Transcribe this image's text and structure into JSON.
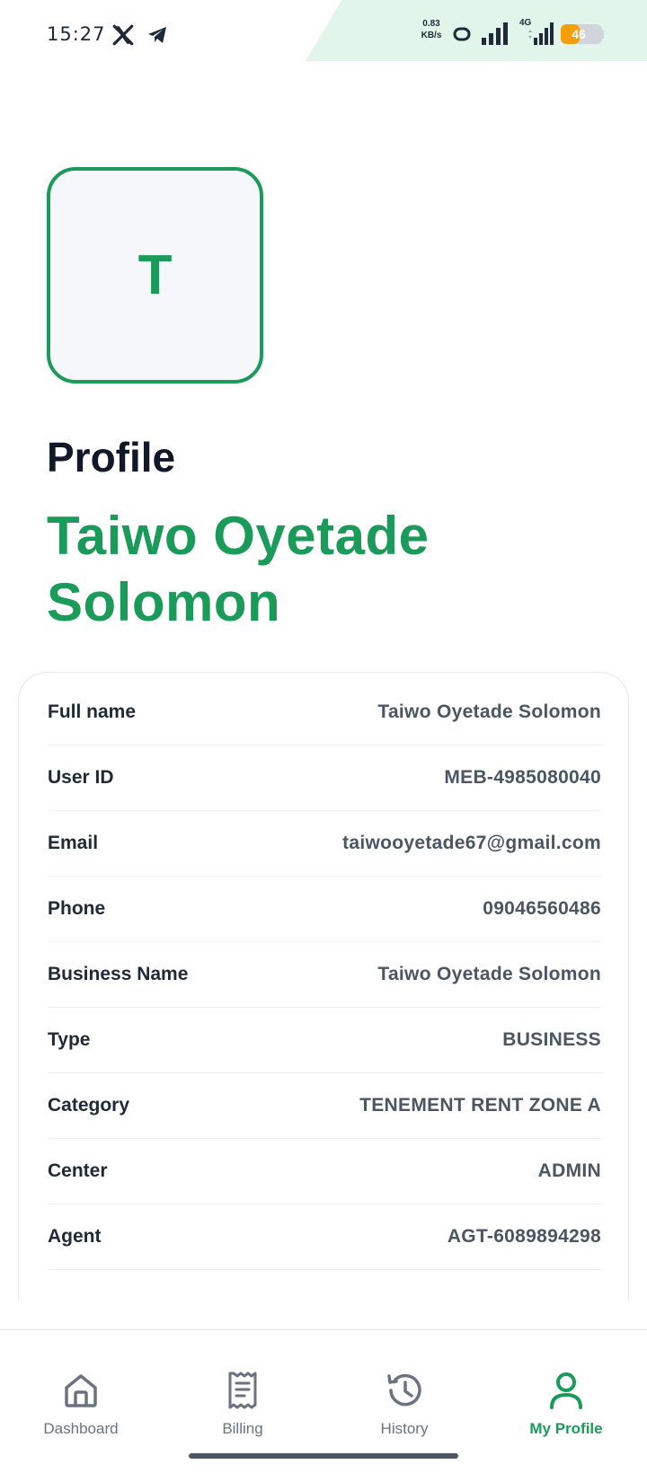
{
  "status_bar": {
    "time": "15:27",
    "net_speed_value": "0.83",
    "net_speed_unit": "KB/s",
    "network_type": "4G",
    "battery_percent": "46",
    "battery_level": 0.46,
    "accent_color": "#e2f5ea"
  },
  "avatar": {
    "initial": "T"
  },
  "page_title": "Profile",
  "user_name": "Taiwo Oyetade Solomon",
  "profile_rows": [
    {
      "label": "Full name",
      "value": "Taiwo Oyetade Solomon"
    },
    {
      "label": "User ID",
      "value": "MEB-4985080040"
    },
    {
      "label": "Email",
      "value": "taiwooyetade67@gmail.com"
    },
    {
      "label": "Phone",
      "value": "09046560486"
    },
    {
      "label": "Business Name",
      "value": "Taiwo Oyetade Solomon"
    },
    {
      "label": "Type",
      "value": "BUSINESS"
    },
    {
      "label": "Category",
      "value": "TENEMENT RENT ZONE A"
    },
    {
      "label": "Center",
      "value": "ADMIN"
    },
    {
      "label": "Agent",
      "value": "AGT-6089894298"
    }
  ],
  "bottom_nav": {
    "items": [
      {
        "label": "Dashboard",
        "icon": "home-icon",
        "active": false
      },
      {
        "label": "Billing",
        "icon": "receipt-icon",
        "active": false
      },
      {
        "label": "History",
        "icon": "history-icon",
        "active": false
      },
      {
        "label": "My Profile",
        "icon": "user-icon",
        "active": true
      }
    ]
  },
  "colors": {
    "brand": "#1a9b5a",
    "text_dark": "#111827",
    "value_gray": "#4b5563",
    "inactive_nav": "#6b7280"
  }
}
